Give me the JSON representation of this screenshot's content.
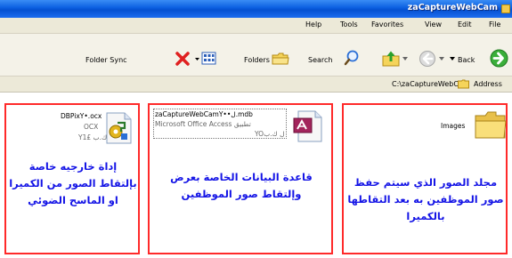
{
  "window": {
    "title": "zaCaptureWebCam"
  },
  "menu": {
    "items": [
      "Help",
      "Tools",
      "Favorites",
      "View",
      "Edit",
      "File"
    ]
  },
  "toolbar": {
    "folder_sync_label": "Folder Sync",
    "folders_label": "Folders",
    "search_label": "Search",
    "back_label": "Back"
  },
  "address": {
    "label": "Address",
    "path": "C:\\zaCaptureWebCam"
  },
  "files": [
    {
      "name": "DBPixY•.ocx",
      "type": "OCX",
      "size": "Y1£ ك.ب",
      "icon": "ocx-file-icon"
    },
    {
      "name": "zaCaptureWebCamY••ل.mdb",
      "type": "Microsoft Office Access تطبيق",
      "size": "YOل ك.ب",
      "icon": "access-database-icon"
    },
    {
      "name": "Images",
      "icon": "folder-icon"
    }
  ],
  "captions": {
    "left": "إداة خارجيه خاصة بإلتقاط الصور من الكميرا او الماسح الضوئي",
    "middle": "قاعدة البيانات الخاصة بعرض وإلتقاط صور الموظفين",
    "right": "مجلد الصور الذي سيتم حفظ صور الموظفين به بعد التقاطها بالكميرا"
  },
  "colors": {
    "title_bar": "#0a5ee0",
    "annotation_border": "#ff2a2a",
    "caption_text": "#1414e6"
  }
}
